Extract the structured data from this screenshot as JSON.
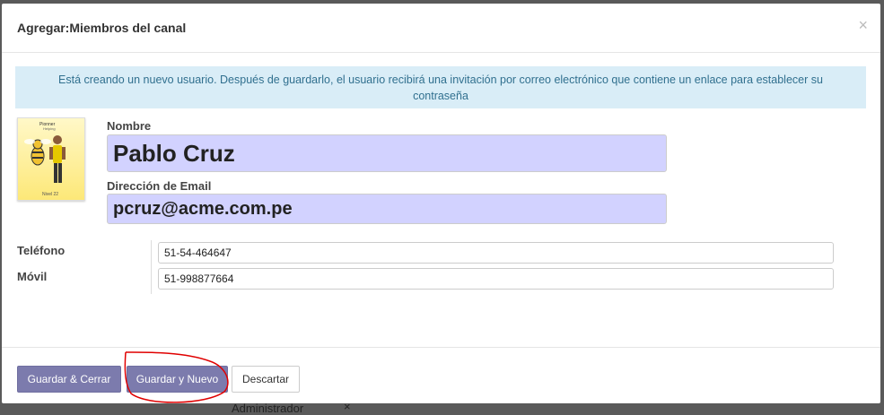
{
  "modal": {
    "title": "Agregar:Miembros del canal",
    "close_symbol": "×"
  },
  "alert": {
    "text": "Está creando un nuevo usuario. Después de guardarlo, el usuario recibirá una invitación por correo electrónico que contiene un enlace para establecer su contraseña"
  },
  "avatar": {
    "top_label": "Pionner",
    "sub_label": "Helping",
    "level": "Nivel 22"
  },
  "form": {
    "name_label": "Nombre",
    "name_value": "Pablo Cruz",
    "email_label": "Dirección de Email",
    "email_value": "pcruz@acme.com.pe",
    "phone_label": "Teléfono",
    "phone_value": "51-54-464647",
    "mobile_label": "Móvil",
    "mobile_value": "51-998877664"
  },
  "footer": {
    "save_close": "Guardar & Cerrar",
    "save_new": "Guardar y Nuevo",
    "discard": "Descartar"
  },
  "background": {
    "text": "Administrador",
    "remove_symbol": "×"
  },
  "colors": {
    "primary": "#7c7bad",
    "highlight_input": "#d2d2ff",
    "alert_bg": "#d9edf7",
    "annotation": "#e00000"
  }
}
